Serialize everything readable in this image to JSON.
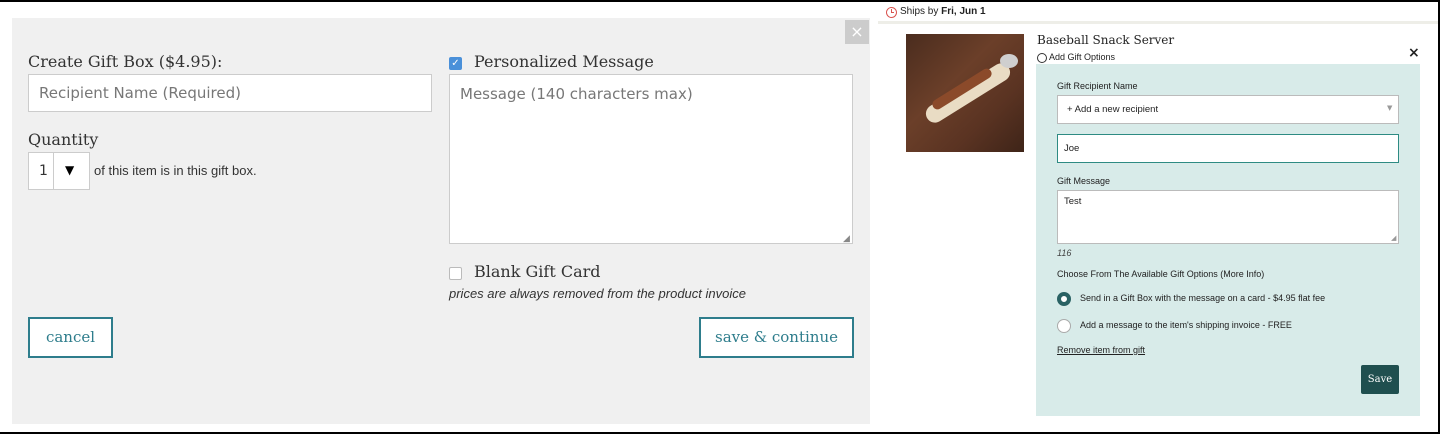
{
  "left": {
    "close_symbol": "×",
    "gift_box_title": "Create Gift Box ($4.95):",
    "recipient_placeholder": "Recipient Name (Required)",
    "quantity_title": "Quantity",
    "quantity_value": "1",
    "quantity_suffix": "of this item is in this gift box.",
    "personalized_message_label": "Personalized Message",
    "personalized_message_checked": true,
    "message_placeholder": "Message (140 characters max)",
    "blank_gift_card_label": "Blank Gift Card",
    "blank_gift_card_checked": false,
    "prices_note": "prices are always removed from the product invoice",
    "cancel_label": "cancel",
    "save_continue_label": "save & continue",
    "accent_color": "#2e7d8c"
  },
  "right": {
    "ships_prefix": "Ships by",
    "ships_date": "Fri, Jun 1",
    "product_title": "Baseball Snack Server",
    "add_gift_options": "Add Gift Options",
    "close_symbol": "×",
    "recipient_name_label": "Gift Recipient Name",
    "recipient_select_value": "+ Add a new recipient",
    "recipient_input_value": "Joe",
    "gift_message_label": "Gift Message",
    "gift_message_value": "Test",
    "char_count": "116",
    "choose_options_text": "Choose From The Available Gift Options (",
    "more_info_link": "More Info",
    "choose_options_close": ")",
    "option_gift_box": "Send in a Gift Box with the message on a card - $4.95 flat fee",
    "option_invoice": "Add a message to the item's shipping invoice - FREE",
    "selected_option": "option_gift_box",
    "remove_link": "Remove item from gift",
    "save_label": "Save",
    "panel_color": "#d8ebe9",
    "save_color": "#1f4f4f"
  }
}
